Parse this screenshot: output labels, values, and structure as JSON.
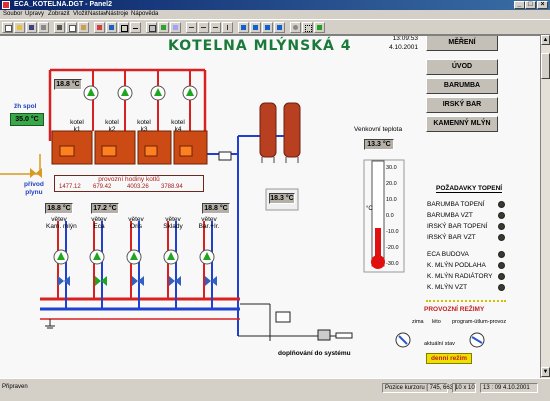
{
  "window": {
    "title": "ECA_KOTELNA.DGT - Panel2",
    "min": "_",
    "max": "□",
    "close": "×"
  },
  "menu": [
    "Soubor",
    "Úpravy",
    "Zobrazit",
    "Vložit",
    "Nastav",
    "Nástroje",
    "Nápověda"
  ],
  "header": {
    "title": "KOTELNA MLÝNSKÁ 4",
    "time": "13:09:53",
    "date": "4.10.2001"
  },
  "nav": [
    "MĚŘENÍ",
    "ÚVOD",
    "BARUMBA",
    "IRSKÝ BAR",
    "KAMENNÝ MLÝN"
  ],
  "outdoor": {
    "label": "Venkovní teplota",
    "value": "13.3 °C",
    "unit": "°C",
    "scale": [
      "30.0",
      "20.0",
      "10.0",
      "0.0",
      "-10.0",
      "-20.0",
      "-30.0"
    ]
  },
  "boiler": {
    "top_temp": "18.8 °C",
    "zh_label": "žh spol",
    "zh_value": "35.0 °C",
    "kettles": [
      "kotel k1",
      "kotel k2",
      "kotel k3",
      "kotel k4"
    ],
    "hours_label": "provozní hodiny kotlů",
    "hours": [
      "1477.12",
      "679.42",
      "4003.26",
      "3788.94"
    ],
    "gas_label": "přívod\nplynu",
    "aux_temp": "18.3 °C"
  },
  "branches": [
    {
      "temp": "18.8 °C",
      "label": "větev\nKam. mlýn"
    },
    {
      "temp": "17.2 °C",
      "label": "větev\nEca"
    },
    {
      "temp": "",
      "label": "větev\nOris"
    },
    {
      "temp": "",
      "label": "větev\nSklady"
    },
    {
      "temp": "18.8 °C",
      "label": "větev\nBar.+Ir."
    }
  ],
  "refill_label": "doplňování do systému",
  "requirements": {
    "title": "POŽADAVKY TOPENÍ",
    "group1": [
      "BARUMBA TOPENÍ",
      "BARUMBA VZT",
      "IRSKÝ BAR TOPENÍ",
      "IRSKÝ BAR VZT"
    ],
    "group2": [
      "ECA BUDOVA",
      "K. MLÝN PODLAHA",
      "K. MLÝN RADIÁTORY",
      "K. MLÝN VZT"
    ]
  },
  "modes": {
    "title": "PROVOZNÍ REŽIMY",
    "winter": "zima",
    "summer": "léto",
    "program": "program-útlum-provoz",
    "current": "aktuální stav",
    "state": "denní režim"
  },
  "status": {
    "left": "Připraven",
    "pos": "Pozice kurzoru [ 745, 663 ]",
    "grid": "10 x 10",
    "time": "13 : 09  4.10.2001"
  },
  "colors": {
    "pump": "#1fa51f",
    "boiler": "#cc4a14",
    "hot": "#d82020",
    "cold": "#2040d0",
    "accent": "#1a7a3a"
  }
}
